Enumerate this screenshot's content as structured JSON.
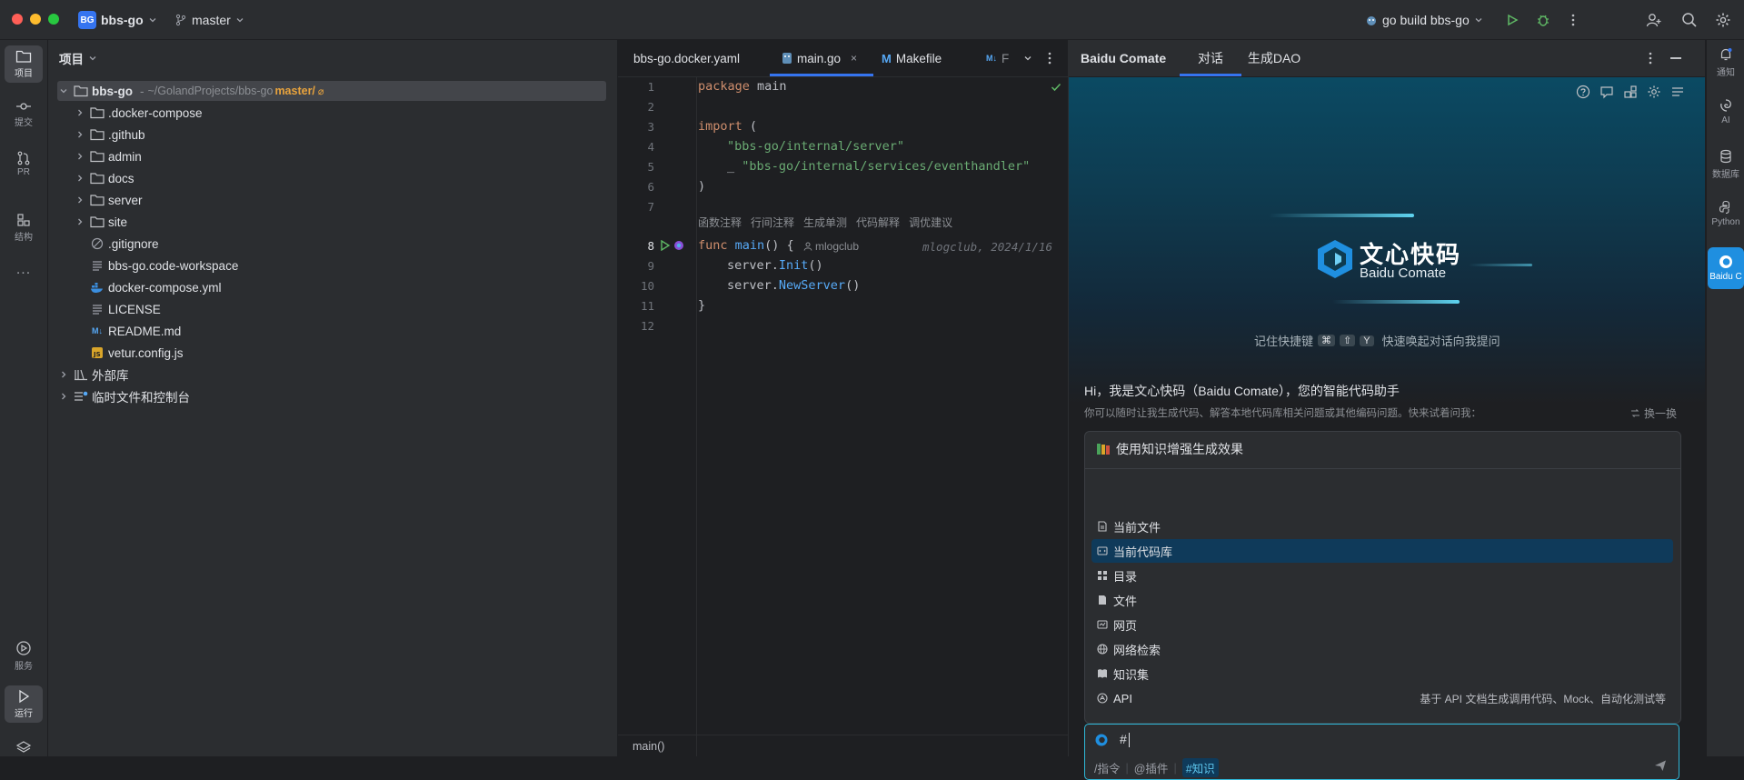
{
  "titlebar": {
    "project_badge": "BG",
    "project_name": "bbs-go",
    "branch": "master",
    "run_config": "go build bbs-go"
  },
  "left_strip": {
    "project": "项目",
    "commit": "提交",
    "pr": "PR",
    "structure": "结构",
    "more": "...",
    "services": "服务",
    "run": "运行"
  },
  "project_panel": {
    "title": "项目",
    "root_name": "bbs-go",
    "root_path": "~/GolandProjects/bbs-go",
    "root_branch": "master/",
    "root_suffix": "⌀",
    "items": [
      {
        "label": ".docker-compose"
      },
      {
        "label": ".github"
      },
      {
        "label": "admin"
      },
      {
        "label": "docs"
      },
      {
        "label": "server"
      },
      {
        "label": "site"
      },
      {
        "label": ".gitignore"
      },
      {
        "label": "bbs-go.code-workspace"
      },
      {
        "label": "docker-compose.yml"
      },
      {
        "label": "LICENSE"
      },
      {
        "label": "README.md"
      },
      {
        "label": "vetur.config.js"
      }
    ],
    "external_libs": "外部库",
    "scratches": "临时文件和控制台"
  },
  "editor": {
    "tabs": [
      {
        "label": "bbs-go.docker.yaml"
      },
      {
        "label": "main.go"
      },
      {
        "label": "Makefile"
      },
      {
        "label": "F"
      }
    ],
    "line_numbers": [
      "1",
      "2",
      "3",
      "4",
      "5",
      "6",
      "7",
      "8",
      "9",
      "10",
      "11",
      "12"
    ],
    "code": {
      "l1_kw": "package",
      "l1_rest": " main",
      "l3_kw": "import",
      "l3_rest": " (",
      "l4": "\"bbs-go/internal/server\"",
      "l5_prefix": "_ ",
      "l5": "\"bbs-go/internal/services/eventhandler\"",
      "l6": ")",
      "l8_kw": "func",
      "l8_fn": "main",
      "l8_rest": "() {",
      "l9_obj": "server.",
      "l9_call": "Init",
      "l9_rest": "()",
      "l10_obj": "server.",
      "l10_call": "NewServer",
      "l10_rest": "()",
      "l11": "}"
    },
    "code_lens": [
      "函数注释",
      "行间注释",
      "生成单测",
      "代码解释",
      "调优建议"
    ],
    "author_hint": "mlogclub",
    "blame": "mlogclub, 2024/1/16",
    "breadcrumb": "main()"
  },
  "comate": {
    "title": "Baidu Comate",
    "tabs": [
      {
        "label": "对话"
      },
      {
        "label": "生成DAO"
      }
    ],
    "logo_cn": "文心快码",
    "logo_en": "Baidu Comate",
    "shortcut_prefix": "记住快捷键",
    "shortcut_keys": [
      "⌘",
      "⇧",
      "Y"
    ],
    "shortcut_suffix": "快速唤起对话向我提问",
    "greeting": "Hi，我是文心快码（Baidu Comate），您的智能代码助手",
    "subtext": "你可以随时让我生成代码、解答本地代码库相关问题或其他编码问题。快来试着问我：",
    "refresh": "换一换",
    "knowledge_title": "使用知识增强生成效果",
    "menu": [
      {
        "label": "当前文件"
      },
      {
        "label": "当前代码库"
      },
      {
        "label": "目录"
      },
      {
        "label": "文件"
      },
      {
        "label": "网页"
      },
      {
        "label": "网络检索"
      },
      {
        "label": "知识集"
      },
      {
        "label": "API"
      }
    ],
    "api_desc": "基于 API 文档生成调用代码、Mock、自动化测试等",
    "input_value": "#",
    "toolbar": {
      "command": "/指令",
      "plugin": "@插件",
      "knowledge": "#知识"
    }
  },
  "right_strip": {
    "notify": "通知",
    "ai": "AI",
    "database": "数据库",
    "python": "Python",
    "comate": "Baidu C"
  },
  "colors": {
    "accent": "#3574f0",
    "active_tab_underline": "#3574f0",
    "comate_highlight": "#0f3a5a",
    "comate_input_border": "#2fb8d8",
    "run_green": "#5fb865"
  }
}
